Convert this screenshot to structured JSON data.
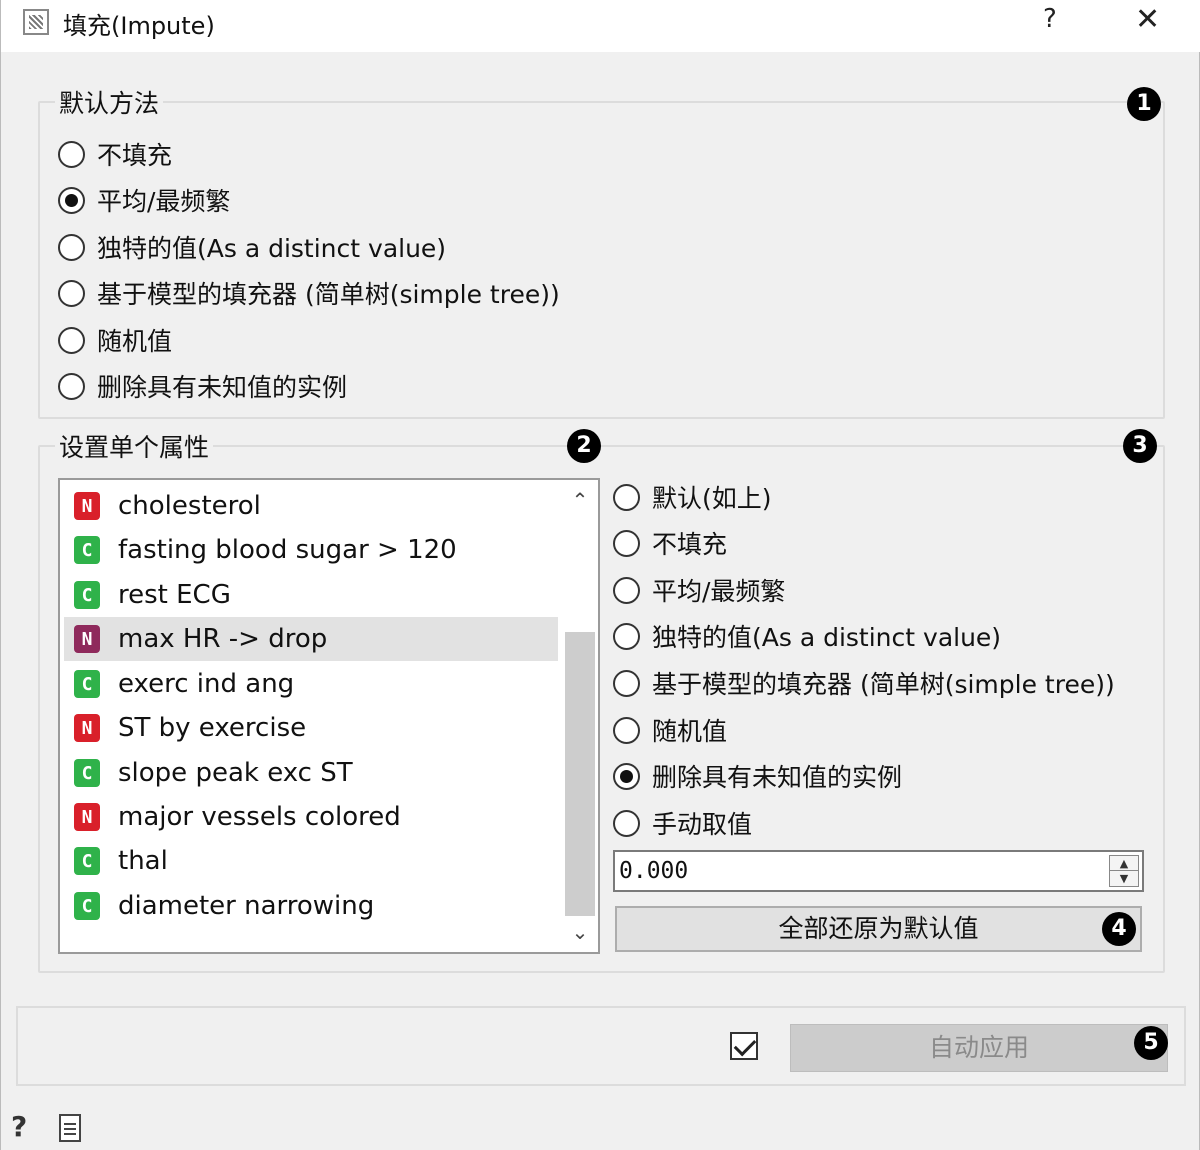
{
  "window": {
    "title": "填充(Impute)",
    "help_glyph": "?",
    "close_glyph": "✕"
  },
  "default_method": {
    "title": "默认方法",
    "marker": "1",
    "options": [
      {
        "label": "不填充",
        "checked": false
      },
      {
        "label": "平均/最频繁",
        "checked": true
      },
      {
        "label": "独特的值(As a distinct value)",
        "checked": false
      },
      {
        "label": "基于模型的填充器 (简单树(simple tree))",
        "checked": false
      },
      {
        "label": "随机值",
        "checked": false
      },
      {
        "label": "删除具有未知值的实例",
        "checked": false
      }
    ]
  },
  "individual": {
    "title": "设置单个属性",
    "marker_list": "2",
    "marker_options": "3",
    "attributes": [
      {
        "type": "N",
        "name": "cholesterol",
        "selected": false
      },
      {
        "type": "C",
        "name": "fasting blood sugar > 120",
        "selected": false
      },
      {
        "type": "C",
        "name": "rest ECG",
        "selected": false
      },
      {
        "type": "N",
        "name": "max HR -> drop",
        "selected": true
      },
      {
        "type": "C",
        "name": "exerc ind ang",
        "selected": false
      },
      {
        "type": "N",
        "name": "ST by exercise",
        "selected": false
      },
      {
        "type": "C",
        "name": "slope peak exc ST",
        "selected": false
      },
      {
        "type": "N",
        "name": "major vessels colored",
        "selected": false
      },
      {
        "type": "C",
        "name": "thal",
        "selected": false
      },
      {
        "type": "C",
        "name": "diameter narrowing",
        "selected": false
      }
    ],
    "options": [
      {
        "label": "默认(如上)",
        "checked": false
      },
      {
        "label": "不填充",
        "checked": false
      },
      {
        "label": "平均/最频繁",
        "checked": false
      },
      {
        "label": "独特的值(As a distinct value)",
        "checked": false
      },
      {
        "label": "基于模型的填充器 (简单树(simple tree))",
        "checked": false
      },
      {
        "label": "随机值",
        "checked": false
      },
      {
        "label": "删除具有未知值的实例",
        "checked": true
      },
      {
        "label": "手动取值",
        "checked": false
      }
    ],
    "manual_value": "0.000",
    "reset_label": "全部还原为默认值",
    "marker_reset": "4"
  },
  "bottom": {
    "auto_apply_checked": true,
    "apply_label": "自动应用",
    "marker_apply": "5"
  },
  "colors": {
    "numeric_badge": "#d9202a",
    "categorical_badge": "#2fb24a",
    "selected_numeric_badge": "#8f2a5c"
  }
}
